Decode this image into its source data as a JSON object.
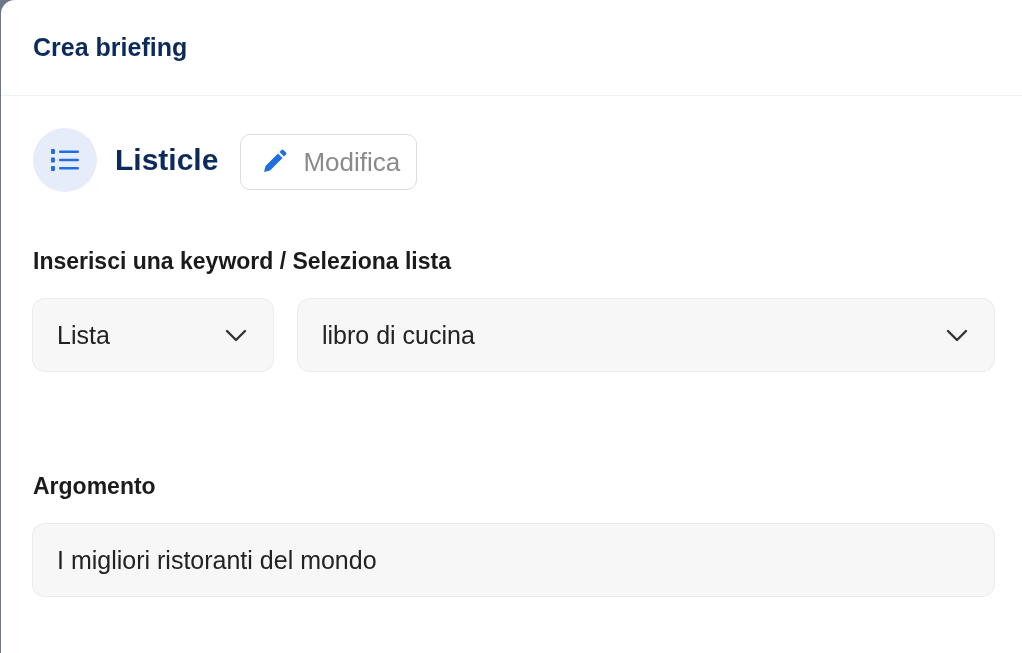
{
  "dialog": {
    "title": "Crea briefing"
  },
  "format": {
    "name": "Listicle",
    "edit_button": "Modifica"
  },
  "source": {
    "label": "Inserisci una keyword / Seleziona lista",
    "type_select": "Lista",
    "list_select": "libro di cucina"
  },
  "topic": {
    "label": "Argomento",
    "value": "I migliori ristoranti del mondo"
  }
}
